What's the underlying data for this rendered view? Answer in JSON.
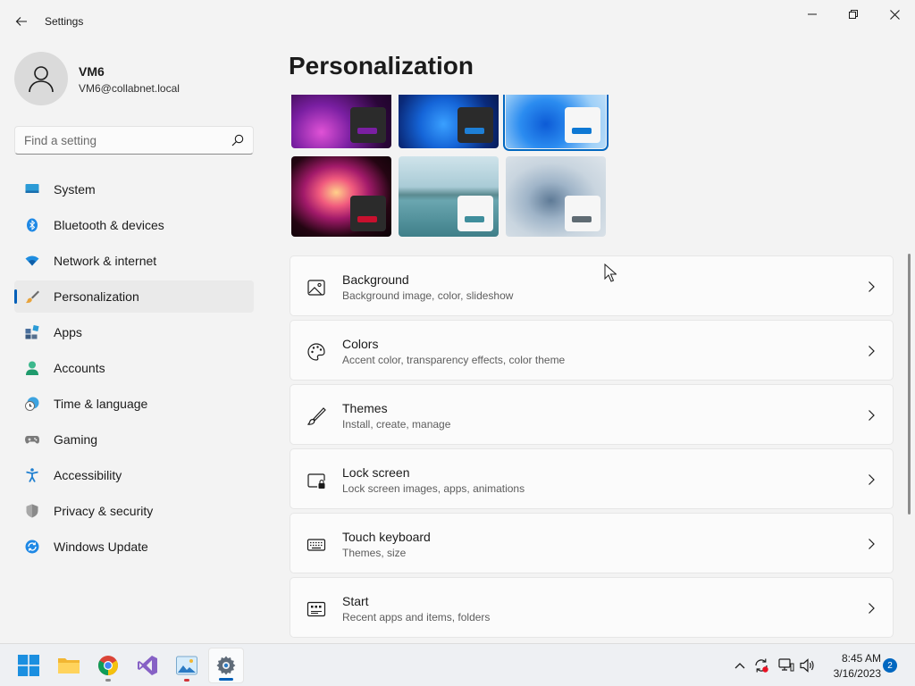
{
  "window": {
    "app_title": "Settings",
    "icons": {
      "back": "back-arrow-icon",
      "minimize": "minimize-icon",
      "maximize": "maximize-icon",
      "close": "close-icon"
    }
  },
  "user": {
    "name": "VM6",
    "email": "VM6@collabnet.local",
    "avatar_icon": "person-icon"
  },
  "search": {
    "placeholder": "Find a setting",
    "value": "",
    "icon": "search-icon"
  },
  "sidebar": {
    "active_index": 3,
    "items": [
      {
        "label": "System",
        "icon": "monitor-icon"
      },
      {
        "label": "Bluetooth & devices",
        "icon": "bluetooth-icon"
      },
      {
        "label": "Network & internet",
        "icon": "wifi-icon"
      },
      {
        "label": "Personalization",
        "icon": "paintbrush-icon"
      },
      {
        "label": "Apps",
        "icon": "apps-grid-icon"
      },
      {
        "label": "Accounts",
        "icon": "person-icon"
      },
      {
        "label": "Time & language",
        "icon": "globe-clock-icon"
      },
      {
        "label": "Gaming",
        "icon": "gamepad-icon"
      },
      {
        "label": "Accessibility",
        "icon": "accessibility-icon"
      },
      {
        "label": "Privacy & security",
        "icon": "shield-icon"
      },
      {
        "label": "Windows Update",
        "icon": "sync-icon"
      }
    ]
  },
  "main": {
    "title": "Personalization",
    "themes": {
      "selected_index": 2,
      "items": [
        {
          "name": "purple-glow-theme",
          "accent": "#7a1fa2"
        },
        {
          "name": "windows-dark-theme",
          "accent": "#1e7fd6"
        },
        {
          "name": "windows-light-theme",
          "accent": "#0e78d4"
        },
        {
          "name": "flower-theme",
          "accent": "#c8102e"
        },
        {
          "name": "lake-theme",
          "accent": "#3f8e9c"
        },
        {
          "name": "bloom-silver-theme",
          "accent": "#5f6b73"
        }
      ]
    },
    "settings": [
      {
        "title": "Background",
        "desc": "Background image, color, slideshow",
        "icon": "image-icon"
      },
      {
        "title": "Colors",
        "desc": "Accent color, transparency effects, color theme",
        "icon": "palette-icon"
      },
      {
        "title": "Themes",
        "desc": "Install, create, manage",
        "icon": "pen-brush-icon"
      },
      {
        "title": "Lock screen",
        "desc": "Lock screen images, apps, animations",
        "icon": "lock-screen-icon"
      },
      {
        "title": "Touch keyboard",
        "desc": "Themes, size",
        "icon": "keyboard-icon"
      },
      {
        "title": "Start",
        "desc": "Recent apps and items, folders",
        "icon": "start-menu-icon"
      }
    ]
  },
  "taskbar": {
    "apps": [
      {
        "name": "start-button",
        "icon": "windows-logo-icon",
        "running": false
      },
      {
        "name": "file-explorer",
        "icon": "folder-icon",
        "running": false
      },
      {
        "name": "chrome",
        "icon": "chrome-icon",
        "running": true
      },
      {
        "name": "visual-studio",
        "icon": "visual-studio-icon",
        "running": false
      },
      {
        "name": "photos",
        "icon": "photos-icon",
        "running": true
      },
      {
        "name": "settings",
        "icon": "gear-icon",
        "running": true,
        "active": true
      }
    ],
    "tray": [
      "chevron-up-icon",
      "sync-alert-icon",
      "network-icon",
      "volume-icon"
    ],
    "time": "8:45 AM",
    "date": "3/16/2023",
    "notification_count": "2"
  },
  "colors": {
    "accent": "#005fb8",
    "window_bg": "#f3f3f3",
    "card_bg": "#fbfbfb",
    "taskbar_bg": "#eef0f3"
  }
}
